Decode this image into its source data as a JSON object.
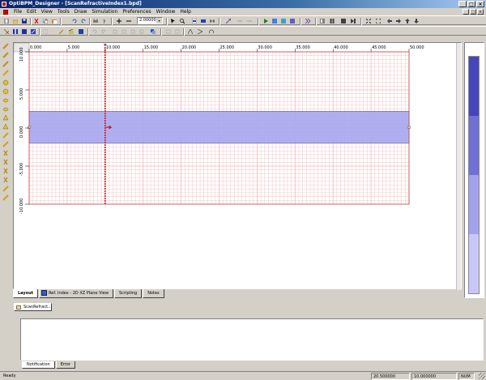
{
  "window": {
    "title": "OptiBPM_Designer - [ScanRefractiveIndex1.bpd]",
    "app_icon": "app-icon",
    "controls": [
      "_",
      "□",
      "×"
    ]
  },
  "menubar": {
    "items": [
      "File",
      "Edit",
      "View",
      "Tools",
      "Draw",
      "Simulation",
      "Preferences",
      "Window",
      "Help"
    ],
    "mdi_controls": [
      "_",
      "□",
      "×"
    ]
  },
  "toolbar": {
    "zoom_value": "2.00000",
    "zoom_arrow": "▾"
  },
  "canvas": {
    "x_ticks": [
      "0.000",
      "5.000",
      "10.000",
      "15.000",
      "20.000",
      "25.000",
      "30.000",
      "35.000",
      "40.000",
      "45.000",
      "50.000"
    ],
    "y_ticks": [
      "10.000",
      "5.000",
      "0.000",
      "-5.000",
      "-10.000"
    ],
    "waveguide_color": "#a6a6ee",
    "grid_color": "#f0b8b8",
    "border_color": "#cc4444",
    "marker_color": "#c82020"
  },
  "refractive_bar": {
    "colors": [
      "#4646bb",
      "#7070d6",
      "#a2a2ec",
      "#c8c8f8"
    ]
  },
  "layout_tabs": {
    "items": [
      "Layout",
      "Ref. Index - 2D XZ Plane View",
      "Scripting",
      "Notes"
    ],
    "active": 0
  },
  "document_tab": {
    "label": "ScanRefract..."
  },
  "output_tabs": {
    "items": [
      "Notification",
      "Error"
    ],
    "active": 0
  },
  "status": {
    "ready": "Ready",
    "x": "20.500000",
    "y": "10.000000",
    "num": "NUM"
  }
}
